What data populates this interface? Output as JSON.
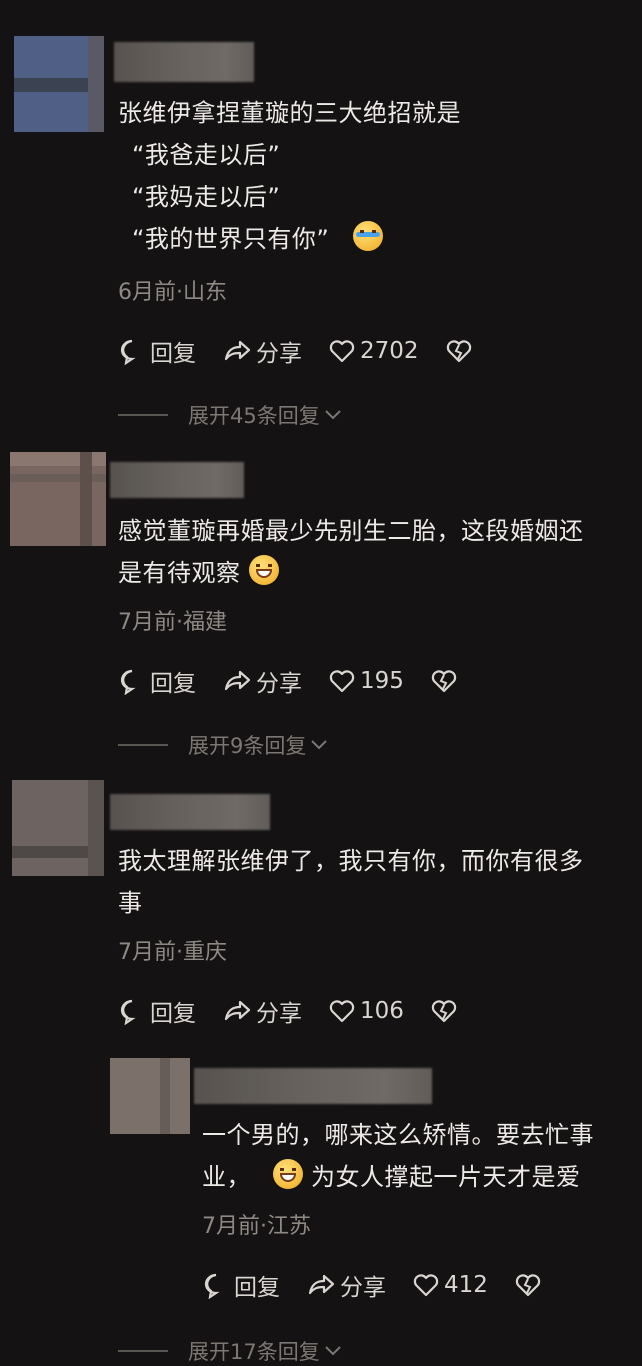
{
  "comments": [
    {
      "lines": [
        "张维伊拿捏董璇的三大绝招就是",
        "“我爸走以后”",
        "“我妈走以后”",
        "“我的世界只有你”"
      ],
      "emoji": "crying-laughing-emoji",
      "meta": "6月前·山东",
      "reply": "回复",
      "share": "分享",
      "likes": "2702",
      "expand": "展开45条回复"
    },
    {
      "lines": [
        "感觉董璇再婚最少先别生二胎，这段婚姻还",
        "是有待观察"
      ],
      "emoji": "sweat-grin-emoji",
      "meta": "7月前·福建",
      "reply": "回复",
      "share": "分享",
      "likes": "195",
      "expand": "展开9条回复"
    },
    {
      "lines": [
        "我太理解张维伊了，我只有你，而你有很多",
        "事"
      ],
      "meta": "7月前·重庆",
      "reply": "回复",
      "share": "分享",
      "likes": "106"
    },
    {
      "lines": [
        "一个男的，哪来这么矫情。要去忙事",
        "业，",
        "为女人撑起一片天才是爱"
      ],
      "emoji": "grinning-emoji",
      "meta": "7月前·江苏",
      "reply": "回复",
      "share": "分享",
      "likes": "412",
      "expand": "展开17条回复"
    }
  ],
  "colors": {
    "background": "#141212",
    "text": "#ece9e6",
    "meta": "#8e8984",
    "muted": "#7c7773"
  }
}
